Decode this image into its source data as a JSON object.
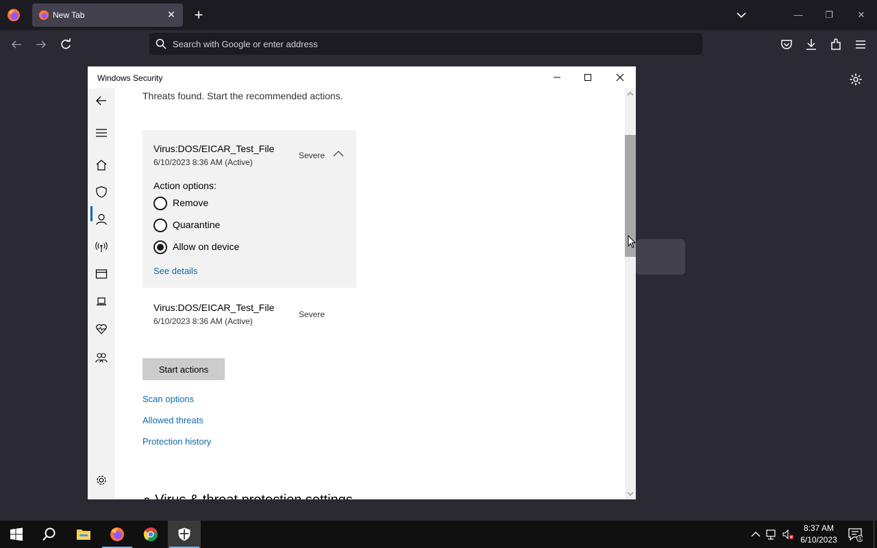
{
  "browser": {
    "tab_title": "New Tab",
    "url_placeholder": "Search with Google or enter address"
  },
  "window": {
    "title": "Windows Security"
  },
  "security": {
    "subheading": "Threats found. Start the recommended actions.",
    "threats": [
      {
        "name": "Virus:DOS/EICAR_Test_File",
        "date": "6/10/2023 8:36 AM (Active)",
        "severity": "Severe"
      },
      {
        "name": "Virus:DOS/EICAR_Test_File",
        "date": "6/10/2023 8:36 AM (Active)",
        "severity": "Severe"
      }
    ],
    "action_label": "Action options:",
    "options": [
      {
        "label": "Remove",
        "selected": false
      },
      {
        "label": "Quarantine",
        "selected": false
      },
      {
        "label": "Allow on device",
        "selected": true
      }
    ],
    "see_details": "See details",
    "start_actions": "Start actions",
    "links": [
      "Scan options",
      "Allowed threats",
      "Protection history"
    ],
    "settings_heading": "Virus & threat protection settings"
  },
  "taskbar": {
    "time": "8:37 AM",
    "date": "6/10/2023",
    "notification_count": "3"
  },
  "colors": {
    "link": "#0b6ba8",
    "accent": "#0067c0",
    "firefox_bg": "#1c1b22"
  }
}
